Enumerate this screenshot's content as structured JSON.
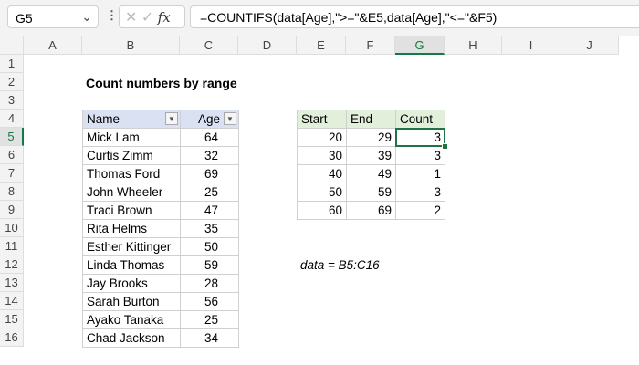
{
  "name_box": "G5",
  "formula": "=COUNTIFS(data[Age],\">=\"&E5,data[Age],\"<=\"&F5)",
  "fx_label": "fx",
  "columns": [
    "A",
    "B",
    "C",
    "D",
    "E",
    "F",
    "G",
    "H",
    "I",
    "J"
  ],
  "rows": [
    "1",
    "2",
    "3",
    "4",
    "5",
    "6",
    "7",
    "8",
    "9",
    "10",
    "11",
    "12",
    "13",
    "14",
    "15",
    "16"
  ],
  "title": "Count numbers by range",
  "data_table": {
    "headers": [
      "Name",
      "Age"
    ],
    "rows": [
      [
        "Mick Lam",
        "64"
      ],
      [
        "Curtis Zimm",
        "32"
      ],
      [
        "Thomas Ford",
        "69"
      ],
      [
        "John Wheeler",
        "25"
      ],
      [
        "Traci Brown",
        "47"
      ],
      [
        "Rita Helms",
        "35"
      ],
      [
        "Esther Kittinger",
        "50"
      ],
      [
        "Linda Thomas",
        "59"
      ],
      [
        "Jay Brooks",
        "28"
      ],
      [
        "Sarah Burton",
        "56"
      ],
      [
        "Ayako Tanaka",
        "25"
      ],
      [
        "Chad Jackson",
        "34"
      ]
    ]
  },
  "summary_table": {
    "headers": [
      "Start",
      "End",
      "Count"
    ],
    "rows": [
      [
        "20",
        "29",
        "3"
      ],
      [
        "30",
        "39",
        "3"
      ],
      [
        "40",
        "49",
        "1"
      ],
      [
        "50",
        "59",
        "3"
      ],
      [
        "60",
        "69",
        "2"
      ]
    ]
  },
  "note": "data = B5:C16"
}
